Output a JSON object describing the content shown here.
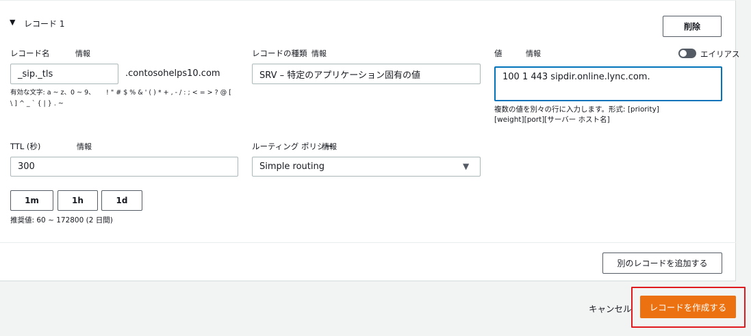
{
  "record": {
    "title": "レコード 1",
    "caret_glyph": "▼",
    "delete_label": "削除"
  },
  "record_name": {
    "label": "レコード名",
    "info": "情報",
    "value": "_sip._tls",
    "suffix": ".contosohelps10.com",
    "hint_line1": "有効な文字: a ~ z、0 ~ 9、",
    "hint_chars": "! \" # $ % & ' ( ) * + , - / : ; < = > ? @ [",
    "hint_line2": "\\ ] ^ _ ` { | } . ~"
  },
  "record_type": {
    "label": "レコードの種類",
    "info": "情報",
    "value": "SRV – 特定のアプリケーション固有の値"
  },
  "value_field": {
    "label": "値",
    "info": "情報",
    "alias_label": "エイリアス",
    "value": "100 1 443 sipdir.online.lync.com.",
    "hint_line1": "複数の値を別々の行に入力します。形式: [priority]",
    "hint_line2": "[weight][port][サーバー ホスト名]"
  },
  "ttl": {
    "label": "TTL (秒)",
    "info": "情報",
    "value": "300",
    "btn_1m": "1m",
    "btn_1h": "1h",
    "btn_1d": "1d",
    "hint": "推奨値: 60 ~ 172800 (2 日間)"
  },
  "routing": {
    "label": "ルーティング ポリシー",
    "info": "情報",
    "value": "Simple routing",
    "caret_glyph": "▼"
  },
  "footer": {
    "add_record_label": "別のレコードを追加する",
    "cancel_label": "キャンセル",
    "create_label": "レコードを作成する"
  },
  "colors": {
    "primary": "#ec7211",
    "focus": "#0073bb",
    "highlight": "#e0191e"
  }
}
